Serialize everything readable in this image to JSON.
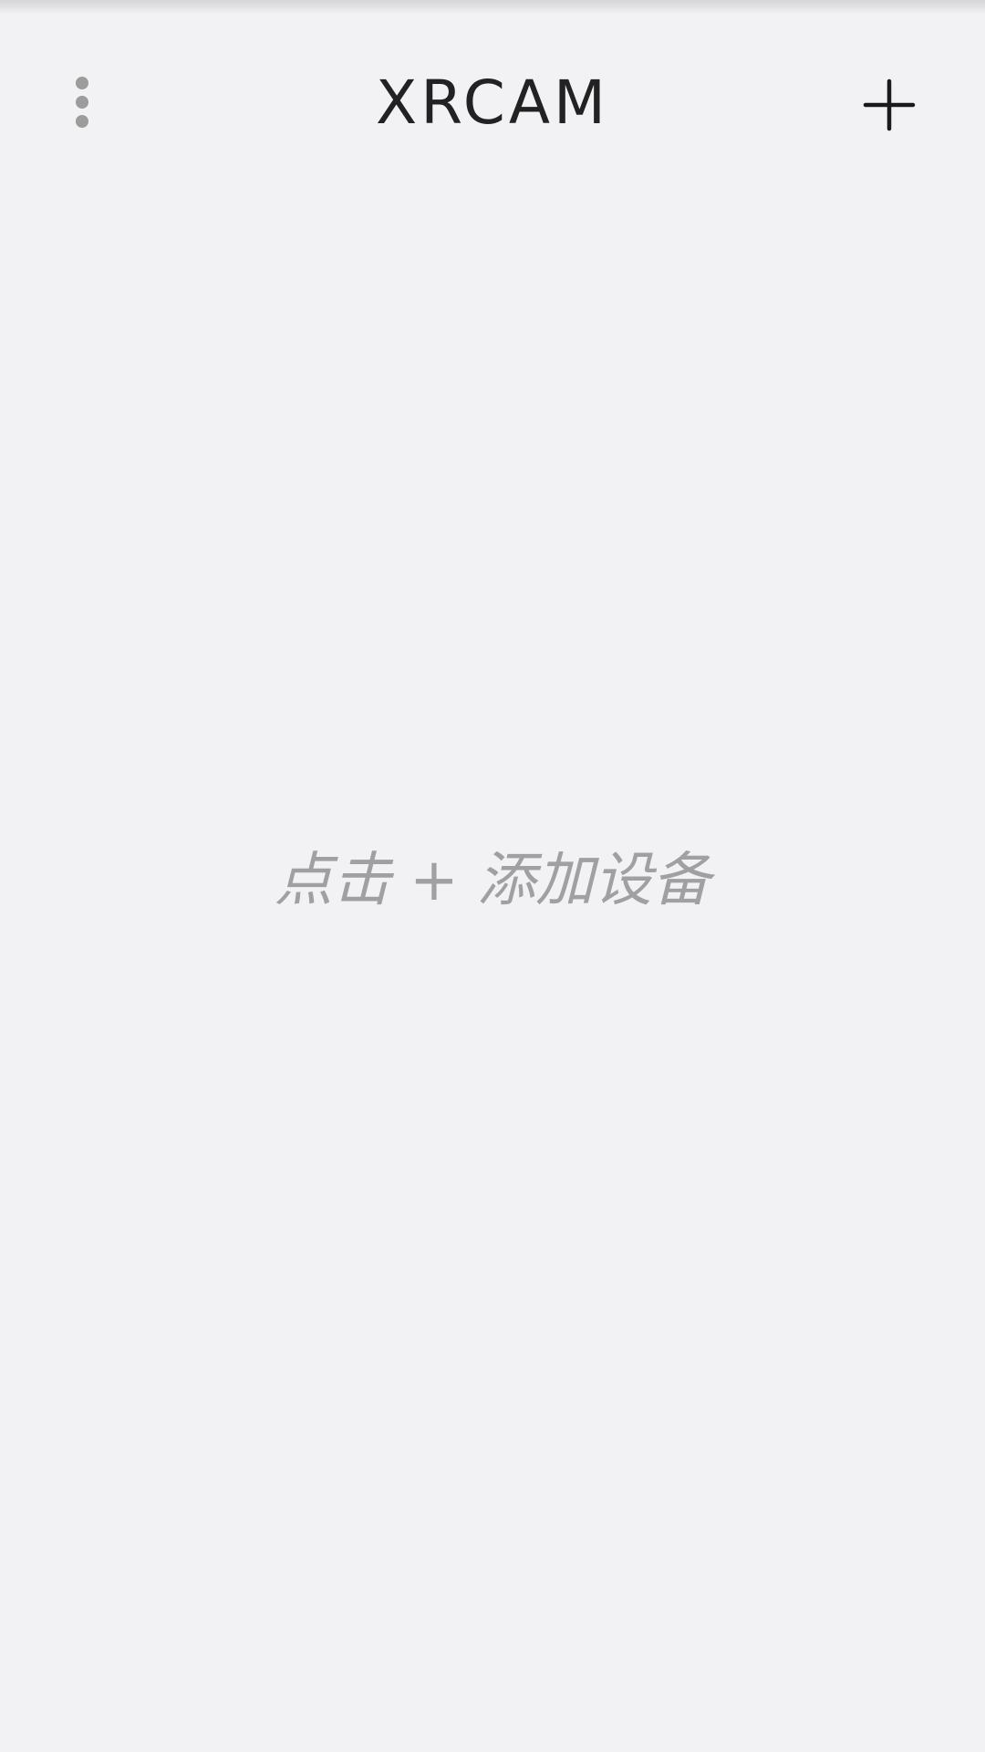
{
  "app_bar": {
    "title": "XRCAM",
    "menu_icon": "more-vert-icon",
    "add_icon": "plus-icon"
  },
  "empty_state": {
    "hint": "点击 + 添加设备"
  },
  "colors": {
    "background": "#f2f2f5",
    "title_text": "#222222",
    "hint_text": "#a0a0a3",
    "menu_icon": "#9c9c9c",
    "add_icon": "#1a1a1a"
  }
}
